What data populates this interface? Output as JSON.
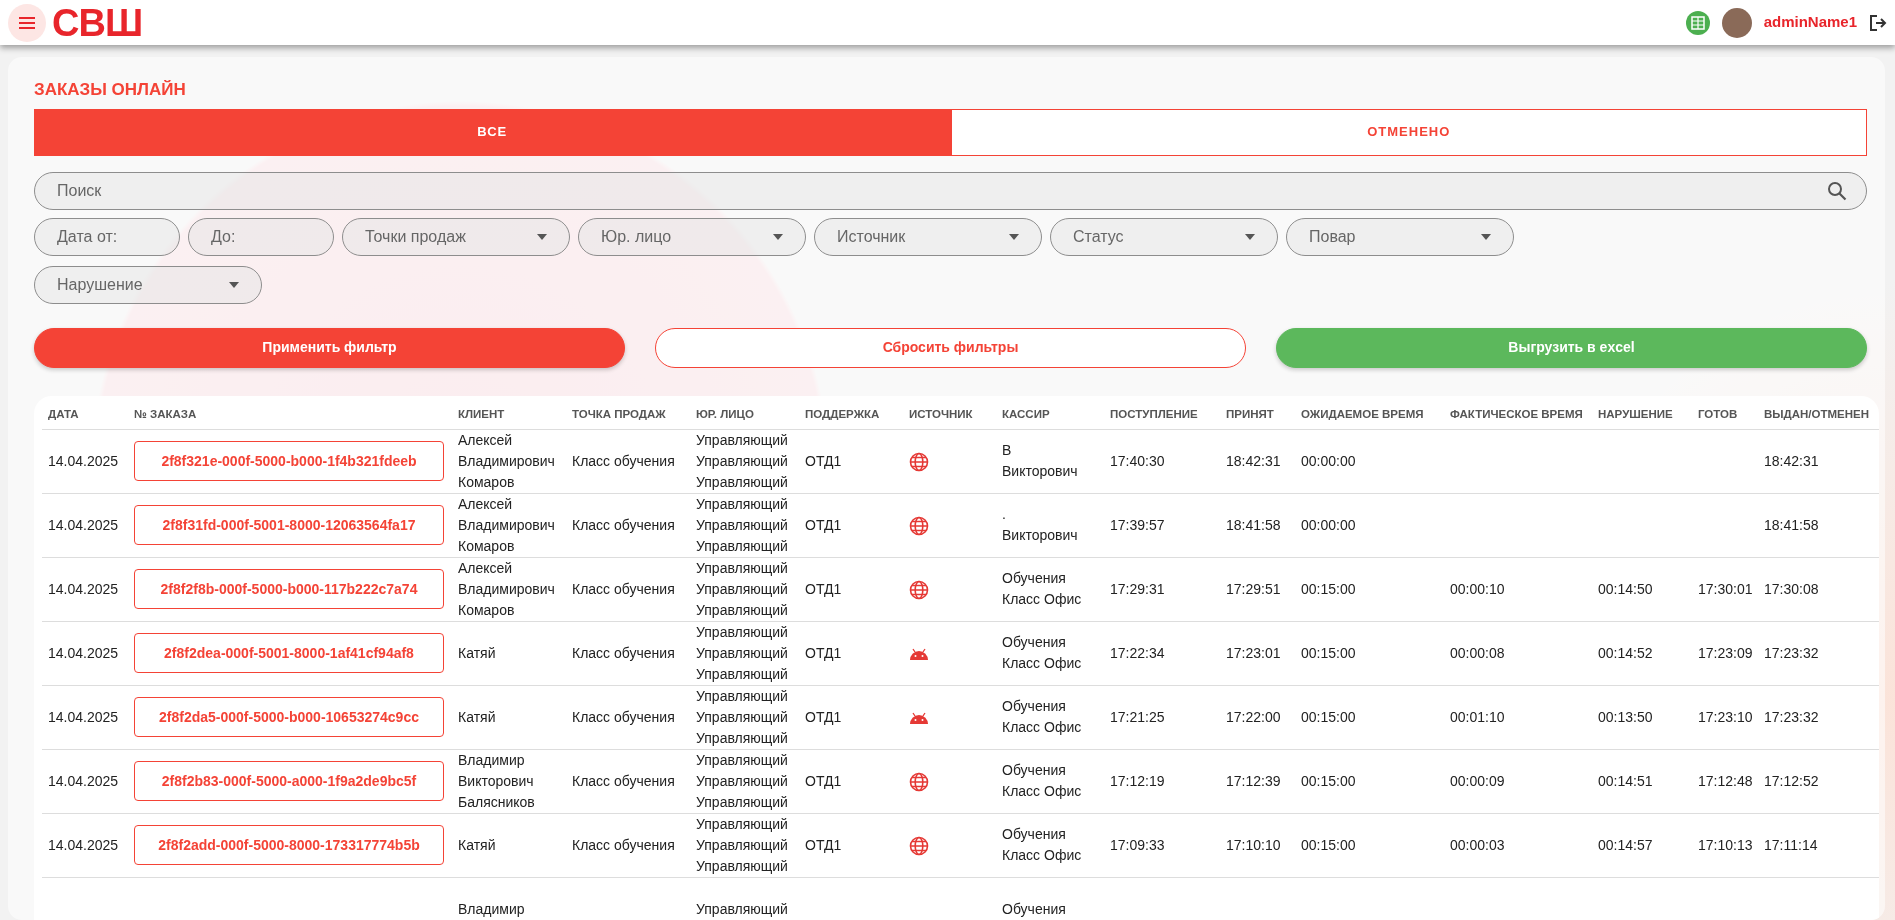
{
  "header": {
    "logo": "СВШ",
    "user": "adminName1"
  },
  "page": {
    "title": "ЗАКАЗЫ ОНЛАЙН"
  },
  "tabs": [
    {
      "label": "ВСЕ",
      "selected": true
    },
    {
      "label": "ОТМЕНЕНО",
      "selected": false
    }
  ],
  "search": {
    "placeholder": "Поиск"
  },
  "filters": [
    {
      "kind": "input",
      "placeholder": "Дата от:"
    },
    {
      "kind": "input",
      "placeholder": "До:"
    },
    {
      "kind": "select",
      "placeholder": "Точки продаж"
    },
    {
      "kind": "select",
      "placeholder": "Юр. лицо"
    },
    {
      "kind": "select",
      "placeholder": "Источник"
    },
    {
      "kind": "select",
      "placeholder": "Статус"
    },
    {
      "kind": "select",
      "placeholder": "Повар"
    },
    {
      "kind": "select",
      "placeholder": "Нарушение"
    }
  ],
  "buttons": [
    {
      "kind": "primary",
      "label": "Применить фильтр"
    },
    {
      "kind": "outline",
      "label": "Сбросить фильтры"
    },
    {
      "kind": "success",
      "label": "Выгрузить в excel"
    }
  ],
  "table": {
    "columns": [
      "ДАТА",
      "№ ЗАКАЗА",
      "КЛИЕНТ",
      "ТОЧКА ПРОДАЖ",
      "ЮР. ЛИЦО",
      "ПОДДЕРЖКА",
      "ИСТОЧНИК",
      "КАССИР",
      "ПОСТУПЛЕНИЕ",
      "ПРИНЯТ",
      "ОЖИДАЕМОЕ ВРЕМЯ",
      "ФАКТИЧЕСКОЕ ВРЕМЯ",
      "НАРУШЕНИЕ",
      "ГОТОВ",
      "ВЫДАН/ОТМЕНЕН"
    ],
    "rows": [
      {
        "date": "14.04.2025",
        "order": "2f8f321e-000f-5000-b000-1f4b321fdeeb",
        "client": [
          "Алексей",
          "Владимирович",
          "Комаров"
        ],
        "point": "Класс обучения",
        "legal": [
          "Управляющий",
          "Управляющий",
          "Управляющий"
        ],
        "support": "ОТД1",
        "source": {
          "kind": "web"
        },
        "cashier": [
          "В",
          "Викторович"
        ],
        "arrival": "17:40:30",
        "accepted": "18:42:31",
        "expected": "00:00:00",
        "actual": "",
        "violation": "",
        "ready": "",
        "issued": "18:42:31"
      },
      {
        "date": "14.04.2025",
        "order": "2f8f31fd-000f-5001-8000-12063564fa17",
        "client": [
          "Алексей",
          "Владимирович",
          "Комаров"
        ],
        "point": "Класс обучения",
        "legal": [
          "Управляющий",
          "Управляющий",
          "Управляющий"
        ],
        "support": "ОТД1",
        "source": {
          "kind": "web"
        },
        "cashier": [
          ".",
          "Викторович"
        ],
        "arrival": "17:39:57",
        "accepted": "18:41:58",
        "expected": "00:00:00",
        "actual": "",
        "violation": "",
        "ready": "",
        "issued": "18:41:58"
      },
      {
        "date": "14.04.2025",
        "order": "2f8f2f8b-000f-5000-b000-117b222c7a74",
        "client": [
          "Алексей",
          "Владимирович",
          "Комаров"
        ],
        "point": "Класс обучения",
        "legal": [
          "Управляющий",
          "Управляющий",
          "Управляющий"
        ],
        "support": "ОТД1",
        "source": {
          "kind": "web"
        },
        "cashier": [
          "Обучения",
          "Класс Офис"
        ],
        "arrival": "17:29:31",
        "accepted": "17:29:51",
        "expected": "00:15:00",
        "actual": "00:00:10",
        "violation": "00:14:50",
        "ready": "17:30:01",
        "issued": "17:30:08"
      },
      {
        "date": "14.04.2025",
        "order": "2f8f2dea-000f-5001-8000-1af41cf94af8",
        "client": [
          "Катяй"
        ],
        "point": "Класс обучения",
        "legal": [
          "Управляющий",
          "Управляющий",
          "Управляющий"
        ],
        "support": "ОТД1",
        "source": {
          "kind": "android"
        },
        "cashier": [
          "Обучения",
          "Класс Офис"
        ],
        "arrival": "17:22:34",
        "accepted": "17:23:01",
        "expected": "00:15:00",
        "actual": "00:00:08",
        "violation": "00:14:52",
        "ready": "17:23:09",
        "issued": "17:23:32"
      },
      {
        "date": "14.04.2025",
        "order": "2f8f2da5-000f-5000-b000-10653274c9cc",
        "client": [
          "Катяй"
        ],
        "point": "Класс обучения",
        "legal": [
          "Управляющий",
          "Управляющий",
          "Управляющий"
        ],
        "support": "ОТД1",
        "source": {
          "kind": "android"
        },
        "cashier": [
          "Обучения",
          "Класс Офис"
        ],
        "arrival": "17:21:25",
        "accepted": "17:22:00",
        "expected": "00:15:00",
        "actual": "00:01:10",
        "violation": "00:13:50",
        "ready": "17:23:10",
        "issued": "17:23:32"
      },
      {
        "date": "14.04.2025",
        "order": "2f8f2b83-000f-5000-a000-1f9a2de9bc5f",
        "client": [
          "Владимир",
          "Викторович",
          "Балясников"
        ],
        "point": "Класс обучения",
        "legal": [
          "Управляющий",
          "Управляющий",
          "Управляющий"
        ],
        "support": "ОТД1",
        "source": {
          "kind": "web"
        },
        "cashier": [
          "Обучения",
          "Класс Офис"
        ],
        "arrival": "17:12:19",
        "accepted": "17:12:39",
        "expected": "00:15:00",
        "actual": "00:00:09",
        "violation": "00:14:51",
        "ready": "17:12:48",
        "issued": "17:12:52"
      },
      {
        "date": "14.04.2025",
        "order": "2f8f2add-000f-5000-8000-173317774b5b",
        "client": [
          "Катяй"
        ],
        "point": "Класс обучения",
        "legal": [
          "Управляющий",
          "Управляющий",
          "Управляющий"
        ],
        "support": "ОТД1",
        "source": {
          "kind": "web"
        },
        "cashier": [
          "Обучения",
          "Класс Офис"
        ],
        "arrival": "17:09:33",
        "accepted": "17:10:10",
        "expected": "00:15:00",
        "actual": "00:00:03",
        "violation": "00:14:57",
        "ready": "17:10:13",
        "issued": "17:11:14"
      },
      {
        "client": [
          "Владимир"
        ],
        "legal": [
          "Управляющий"
        ],
        "cashier": [
          "Обучения"
        ]
      }
    ]
  }
}
